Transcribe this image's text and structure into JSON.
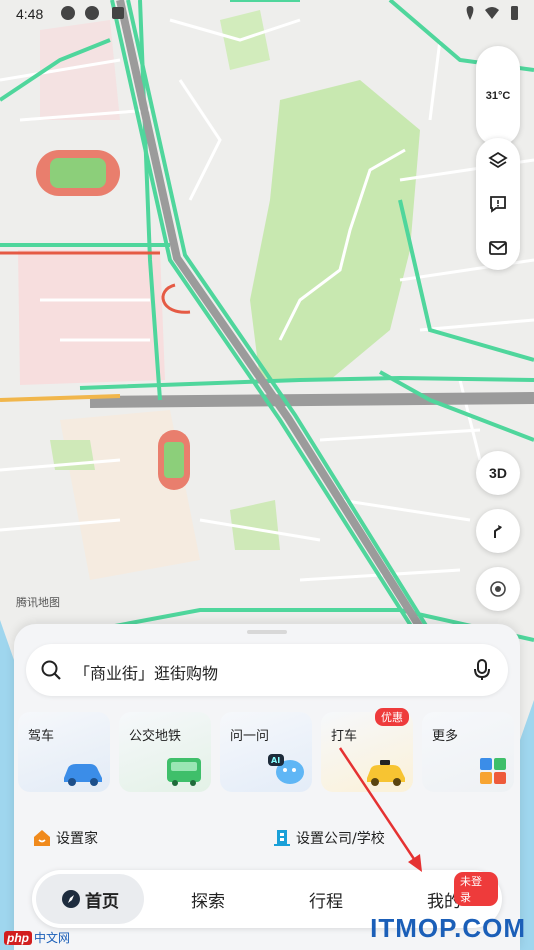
{
  "status_bar": {
    "time": "4:48"
  },
  "map": {
    "weather_temp": "31°C",
    "btn_3d": "3D",
    "watermark": "腾讯地图"
  },
  "search": {
    "placeholder_text": "「商业街」逛街购物"
  },
  "quick_actions": [
    {
      "label": "驾车",
      "icon": "car-icon"
    },
    {
      "label": "公交地铁",
      "icon": "bus-icon"
    },
    {
      "label": "问一问",
      "icon": "ai-assistant-icon"
    },
    {
      "label": "打车",
      "icon": "taxi-icon",
      "badge": "优惠"
    },
    {
      "label": "更多",
      "icon": "apps-grid-icon"
    }
  ],
  "shortcuts": {
    "home": "设置家",
    "work": "设置公司/学校"
  },
  "tabbar": {
    "tabs": [
      {
        "label": "首页",
        "active": true
      },
      {
        "label": "探索"
      },
      {
        "label": "行程"
      },
      {
        "label": "我的",
        "badge": "未登录"
      }
    ]
  },
  "watermarks": {
    "itmop": "ITMOP.COM",
    "php_cn": "中文网",
    "php_logo": "php"
  },
  "colors": {
    "road_green": "#4fd69c",
    "accent_red": "#ee3b3b",
    "park_green": "#c8e8b0"
  }
}
